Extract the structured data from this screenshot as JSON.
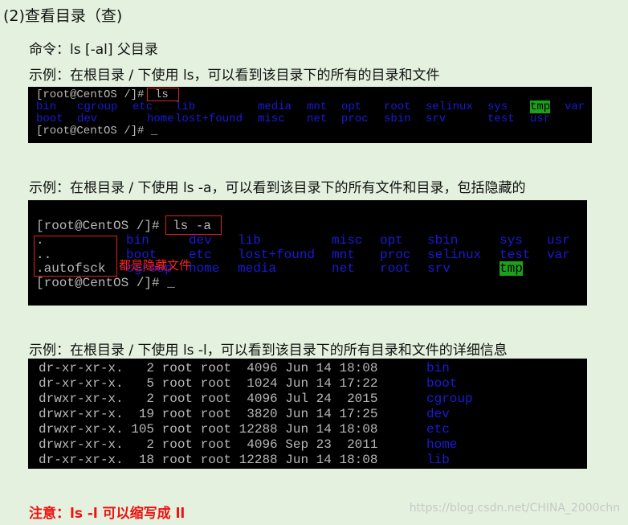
{
  "heading": "(2)查看目录（查)",
  "command_line": "命令：ls [-al] 父目录",
  "example1": "示例：在根目录 / 下使用 ls，可以看到该目录下的所有的目录和文件",
  "example2": "示例：在根目录 / 下使用 ls -a，可以看到该目录下的所有文件和目录，包括隐藏的",
  "example3": "示例：在根目录 / 下使用 ls -l，可以看到该目录下的所有目录和文件的详细信息",
  "note": "注意：ls -l 可以缩写成 ll",
  "watermark": "https://blog.csdn.net/CHINA_2000chn",
  "colors": {
    "background": "#e3f1de",
    "dir": "#1a1ad8",
    "highlight": "#1aa31a",
    "annotation": "#e02020"
  },
  "term1": {
    "prompt": "[root@CentOS /]# ",
    "cmd": "ls",
    "end_prompt": "[root@CentOS /]# _",
    "row1": [
      "bin",
      "cgroup",
      "etc",
      "lib",
      "media",
      "mnt",
      "opt",
      "root",
      "selinux",
      "sys",
      "tmp",
      "var"
    ],
    "row2": [
      "boot",
      "dev",
      "home",
      "lost+found",
      "misc",
      "net",
      "proc",
      "sbin",
      "srv",
      "test",
      "usr"
    ]
  },
  "term2": {
    "prompt": "[root@CentOS /]# ",
    "cmd": "ls -a",
    "end_prompt": "[root@CentOS /]# _",
    "hidden": [
      ".",
      "..",
      ".autofsck"
    ],
    "annotation": "都是隐藏文件",
    "row1": [
      "bin",
      "dev",
      "lib",
      "misc",
      "opt",
      "sbin",
      "sys",
      "usr"
    ],
    "row2": [
      "boot",
      "etc",
      "lost+found",
      "mnt",
      "proc",
      "selinux",
      "test",
      "var"
    ],
    "row3": [
      "cgroup",
      "home",
      "media",
      "net",
      "root",
      "srv",
      "tmp"
    ]
  },
  "term3": {
    "rows": [
      {
        "meta": "dr-xr-xr-x.   2 root root  4096 Jun 14 18:08 ",
        "name": "bin"
      },
      {
        "meta": "dr-xr-xr-x.   5 root root  1024 Jun 14 17:22 ",
        "name": "boot"
      },
      {
        "meta": "drwxr-xr-x.   2 root root  4096 Jul 24  2015 ",
        "name": "cgroup"
      },
      {
        "meta": "drwxr-xr-x.  19 root root  3820 Jun 14 17:25 ",
        "name": "dev"
      },
      {
        "meta": "drwxr-xr-x. 105 root root 12288 Jun 14 18:08 ",
        "name": "etc"
      },
      {
        "meta": "drwxr-xr-x.   2 root root  4096 Sep 23  2011 ",
        "name": "home"
      },
      {
        "meta": "dr-xr-xr-x.  18 root root 12288 Jun 14 18:08 ",
        "name": "lib"
      }
    ]
  }
}
